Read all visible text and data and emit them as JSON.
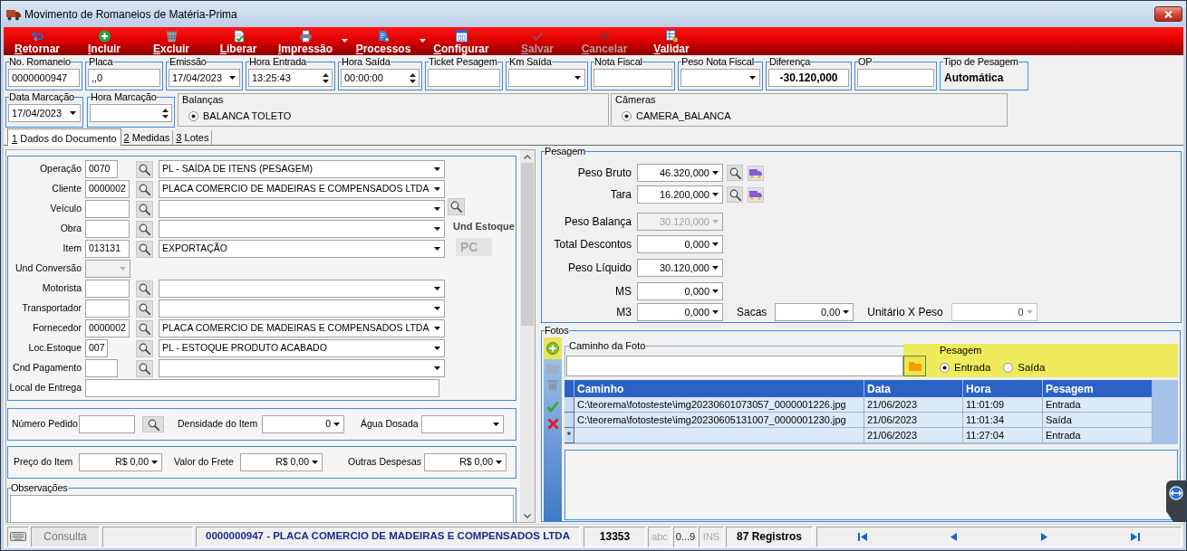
{
  "window": {
    "title": "Movimento de Romaneios de Matéria-Prima"
  },
  "toolbar": [
    {
      "label": "Retornar",
      "disabled": false,
      "dropdown": false
    },
    {
      "label": "Incluir",
      "disabled": false,
      "dropdown": false
    },
    {
      "label": "Excluir",
      "disabled": false,
      "dropdown": false
    },
    {
      "label": "Liberar",
      "disabled": false,
      "dropdown": false
    },
    {
      "label": "Impressão",
      "disabled": false,
      "dropdown": true
    },
    {
      "label": "Processos",
      "disabled": false,
      "dropdown": true
    },
    {
      "label": "Configurar",
      "disabled": false,
      "dropdown": false
    },
    {
      "label": "Salvar",
      "disabled": true,
      "dropdown": false
    },
    {
      "label": "Cancelar",
      "disabled": true,
      "dropdown": false
    },
    {
      "label": "Validar",
      "disabled": false,
      "dropdown": false
    }
  ],
  "header_fields": [
    {
      "kind": "text",
      "label": "No. Romaneio",
      "value": "0000000947"
    },
    {
      "kind": "text",
      "label": "Placa",
      "value": ",,0"
    },
    {
      "kind": "combo",
      "label": "Emissão",
      "value": "17/04/2023"
    },
    {
      "kind": "spin",
      "label": "Hora Entrada",
      "value": "13:25:43"
    },
    {
      "kind": "spin",
      "label": "Hora Saída",
      "value": "00:00:00"
    },
    {
      "kind": "text",
      "label": "Ticket Pesagem"
    },
    {
      "kind": "combo",
      "label": "Km Saída"
    },
    {
      "kind": "text",
      "label": "Nota Fiscal"
    },
    {
      "kind": "combo",
      "label": "Peso Nota Fiscal"
    },
    {
      "kind": "total",
      "label": "Diferença",
      "value": "-30.120,000"
    },
    {
      "kind": "text",
      "label": "OP"
    },
    {
      "kind": "static",
      "label": "Tipo de Pesagem",
      "value": "Automática"
    }
  ],
  "marking_fields": [
    {
      "kind": "combo",
      "label": "Data Marcação",
      "value": "17/04/2023"
    },
    {
      "kind": "spin",
      "label": "Hora Marcação"
    }
  ],
  "balancas": {
    "title": "Balanças",
    "options": [
      {
        "label": "BALANCA TOLETO",
        "selected": true
      }
    ]
  },
  "cameras": {
    "title": "Câmeras",
    "options": [
      {
        "label": "CAMERA_BALANCA",
        "selected": true
      }
    ]
  },
  "tabs": [
    {
      "label": "1 Dados do Documento",
      "selected": true
    },
    {
      "label": "2 Medidas",
      "selected": false
    },
    {
      "label": "3 Lotes",
      "selected": false
    }
  ],
  "document": {
    "rows": [
      {
        "kind": "lookup",
        "label": "Operação",
        "code": "0070",
        "description": "PL - SAÍDA DE ITENS (PESAGEM)"
      },
      {
        "kind": "lookup",
        "label": "Cliente",
        "code": "0000002",
        "description": "PLACA COMERCIO DE MADEIRAS E COMPENSADOS LTDA"
      },
      {
        "kind": "lookup",
        "label": "Veículo"
      },
      {
        "kind": "lookup",
        "label": "Obra"
      },
      {
        "kind": "lookup",
        "label": "Item",
        "code": "013131",
        "description": "EXPORTAÇÃO"
      },
      {
        "kind": "unit",
        "label": "Und Conversão",
        "disabled": true
      },
      {
        "kind": "lookup",
        "label": "Motorista"
      },
      {
        "kind": "lookup",
        "label": "Transportador"
      },
      {
        "kind": "lookup",
        "label": "Fornecedor",
        "code": "0000002",
        "description": "PLACA COMERCIO DE MADEIRAS E COMPENSADOS LTDA"
      },
      {
        "kind": "lookup",
        "label": "Loc.Estoque",
        "code": "007",
        "description": "PL - ESTOQUE PRODUTO ACABADO"
      },
      {
        "kind": "lookup",
        "label": "Cnd Pagamento"
      },
      {
        "kind": "text",
        "label": "Local de Entrega"
      }
    ],
    "stock_unit": {
      "label": "Und Estoque",
      "value": "PC"
    }
  },
  "order": {
    "number": {
      "label": "Número Pedido"
    },
    "density": {
      "label": "Densidade do Item",
      "value": "0"
    },
    "water": {
      "label": "Água Dosada"
    }
  },
  "costs": [
    {
      "label": "Preço do Item",
      "value": "R$ 0,00"
    },
    {
      "label": "Valor do Frete",
      "value": "R$ 0,00"
    },
    {
      "label": "Outras Despesas",
      "value": "R$ 0,00"
    }
  ],
  "notes": {
    "label": "Observações"
  },
  "weighing": {
    "title": "Pesagem",
    "rows": [
      {
        "kind": "scale",
        "label": "Peso Bruto",
        "value": "46.320,000",
        "disabled": false
      },
      {
        "kind": "scale",
        "label": "Tara",
        "value": "16.200,000",
        "disabled": false
      },
      {
        "kind": "plain",
        "label": "Peso Balança",
        "value": "30.120,000",
        "disabled": true
      },
      {
        "kind": "plain",
        "label": "Total Descontos",
        "value": "0,000",
        "disabled": false
      },
      {
        "kind": "plain",
        "label": "Peso Líquido",
        "value": "30.120,000",
        "disabled": false
      },
      {
        "kind": "plain",
        "label": "MS",
        "value": "0,000",
        "disabled": false
      },
      {
        "kind": "plain",
        "label": "M3",
        "value": "0,000",
        "disabled": false,
        "extras": [
          {
            "label": "Sacas",
            "value": "0,00",
            "disabled": false
          },
          {
            "label": "Unitário X Peso",
            "value": "0",
            "disabled": true
          }
        ]
      }
    ]
  },
  "photos": {
    "title": "Fotos",
    "tools": [
      {
        "disabled": false,
        "highlighted": true
      },
      {
        "disabled": true,
        "highlighted": false
      },
      {
        "disabled": true,
        "highlighted": false
      },
      {
        "disabled": false,
        "highlighted": false
      },
      {
        "disabled": false,
        "highlighted": false
      }
    ],
    "path": {
      "label": "Caminho da Foto"
    },
    "weighing_type": {
      "label": "Pesagem",
      "options": [
        {
          "label": "Entrada",
          "selected": true
        },
        {
          "label": "Saída",
          "selected": false
        }
      ]
    },
    "grid": {
      "columns": [
        "Caminho",
        "Data",
        "Hora",
        "Pesagem"
      ],
      "rows": [
        {
          "cells": [
            "C:\\teorema\\fotosteste\\img20230601073057_0000001226.jpg",
            "21/06/2023",
            "11:01:09",
            "Entrada"
          ]
        },
        {
          "cells": [
            "C:\\teorema\\fotosteste\\img20230605131007_0000001230.jpg",
            "21/06/2023",
            "11:01:34",
            "Saída"
          ]
        },
        {
          "marker": "*",
          "cells": [
            null,
            "21/06/2023",
            "11:27:04",
            "Entrada"
          ]
        }
      ]
    }
  },
  "status_bar": {
    "mode": "Consulta",
    "record": "0000000947 - PLACA COMERCIO DE MADEIRAS E COMPENSADOS LTDA",
    "number": "13353",
    "indicators": [
      {
        "label": "abc",
        "on": false
      },
      {
        "label": "0...9",
        "on": true
      },
      {
        "label": "INS",
        "on": false
      }
    ],
    "count": "87 Registros"
  }
}
